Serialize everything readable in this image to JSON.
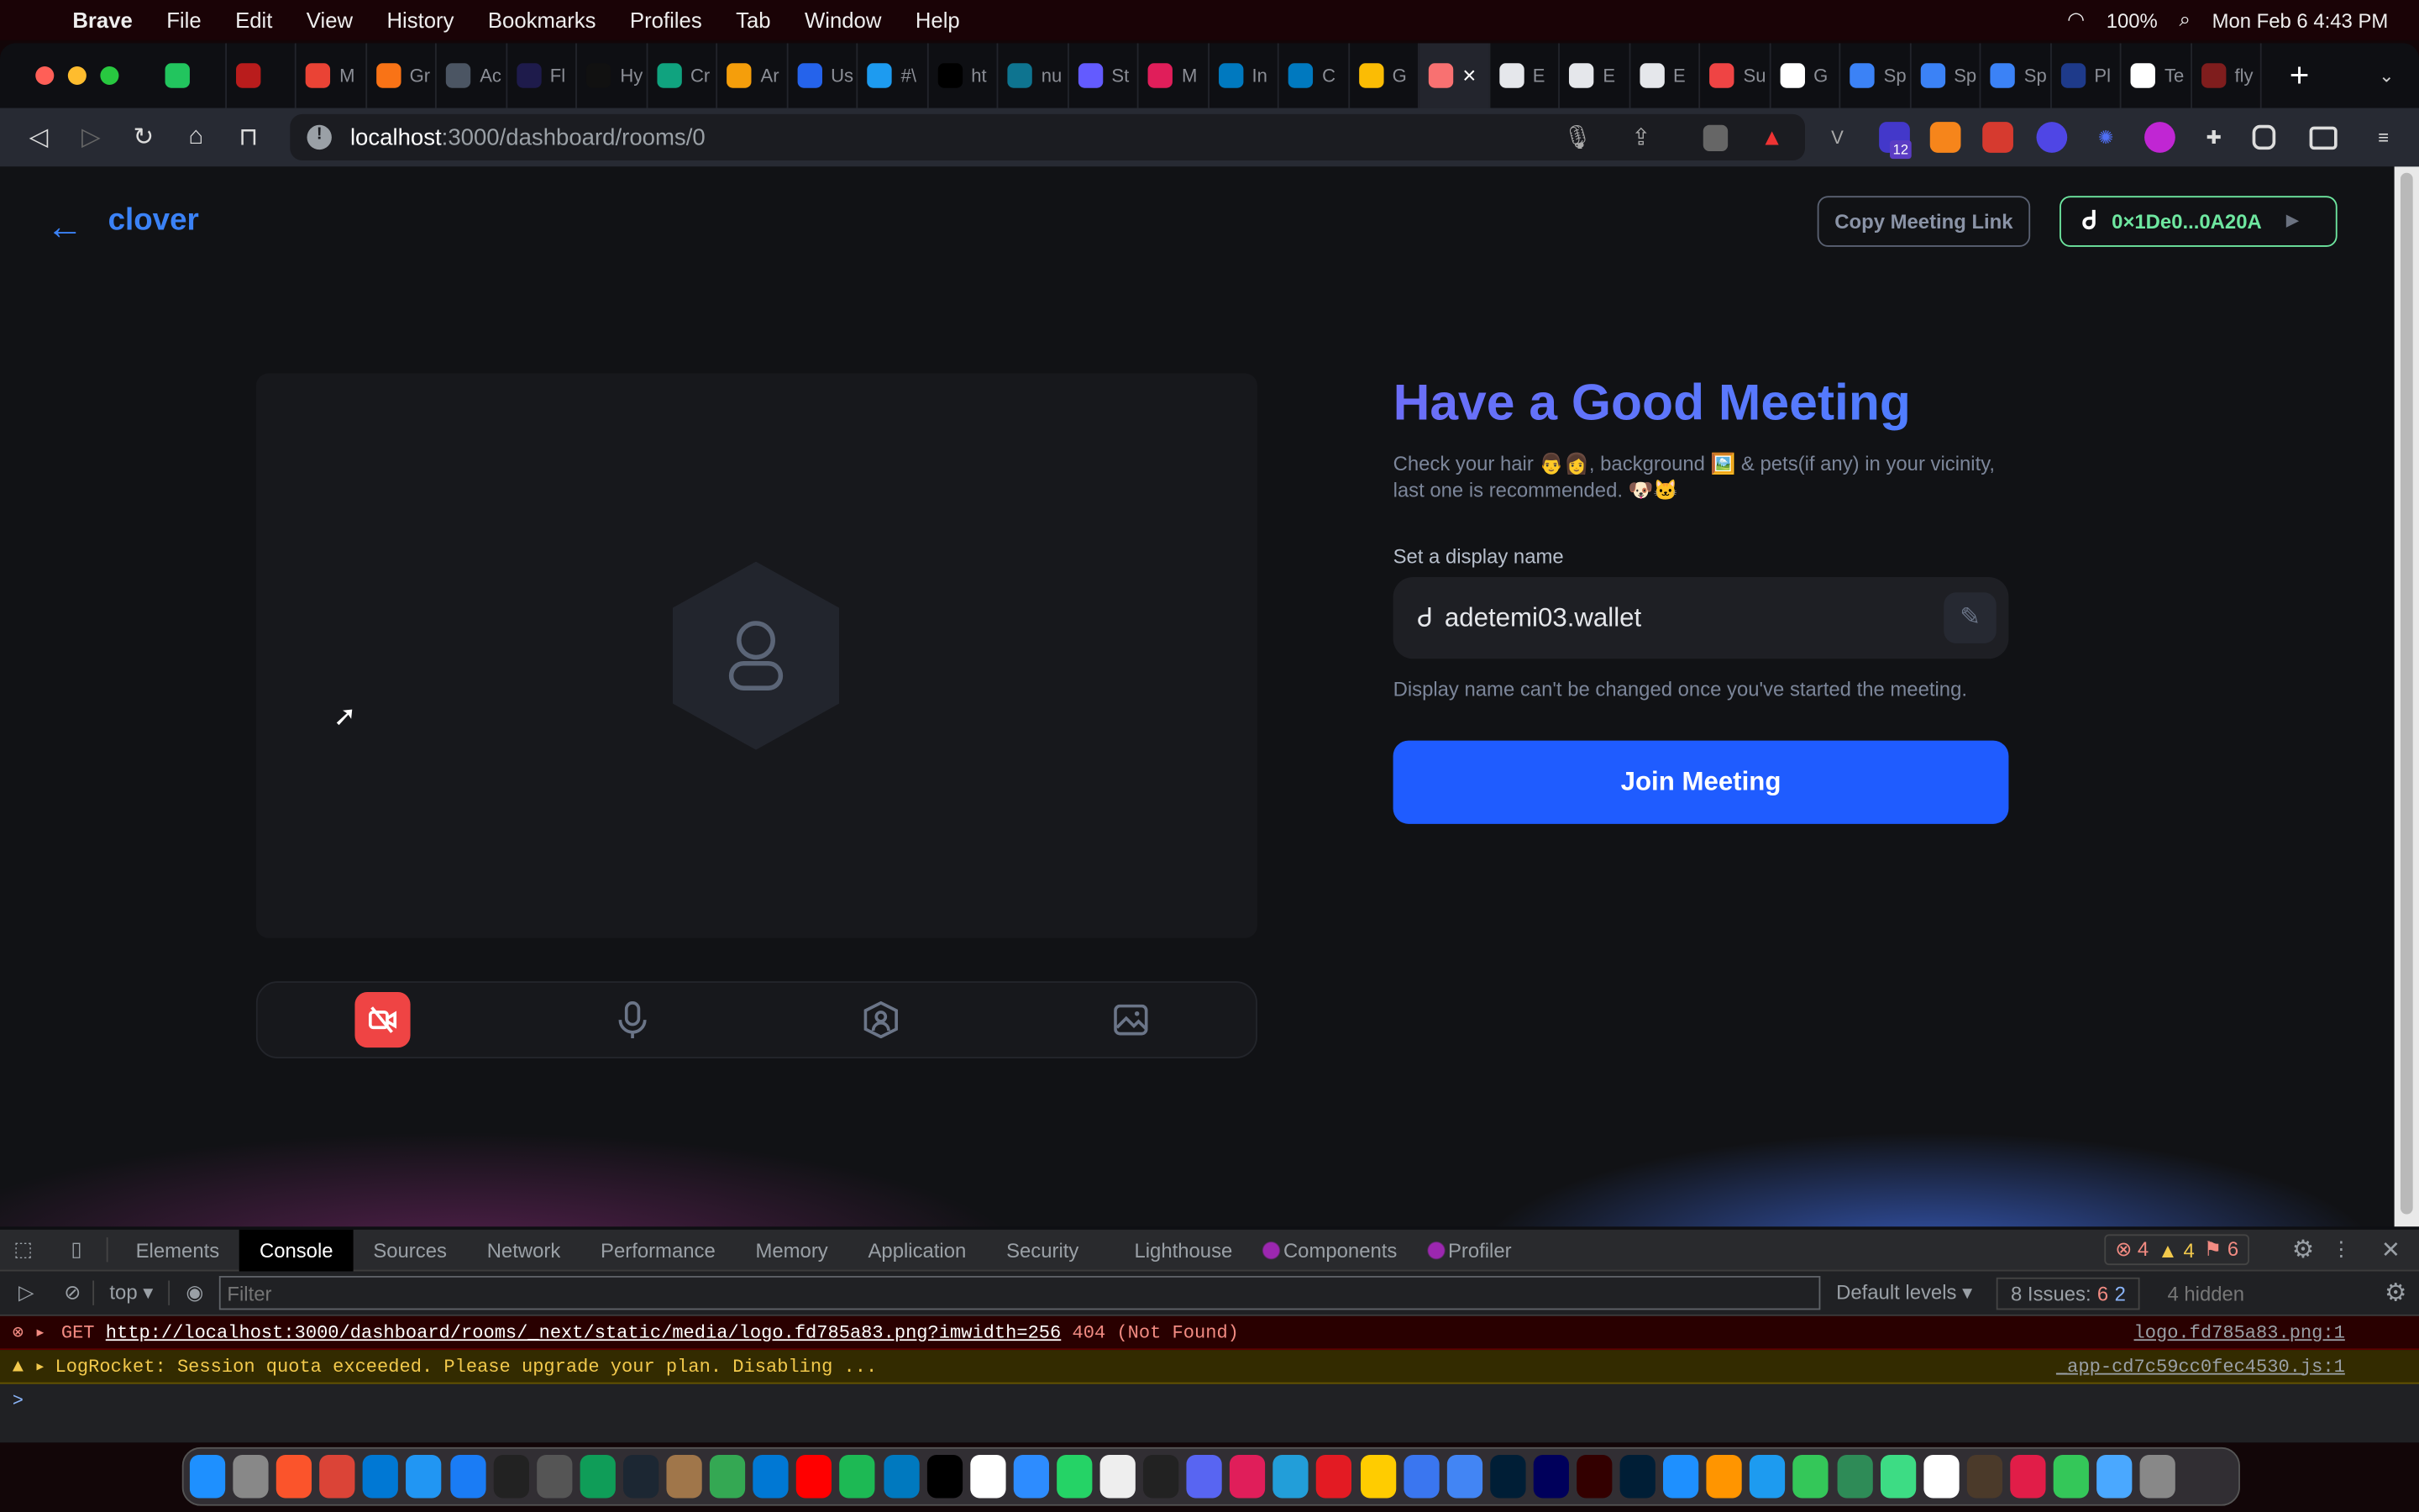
{
  "menubar": {
    "app": "Brave",
    "items": [
      "File",
      "Edit",
      "View",
      "History",
      "Bookmarks",
      "Profiles",
      "Tab",
      "Window",
      "Help"
    ],
    "battery": "100%",
    "clock": "Mon Feb 6  4:43 PM"
  },
  "tabs": [
    {
      "label": "",
      "color": "#22c55e"
    },
    {
      "label": "",
      "color": "#b91c1c"
    },
    {
      "label": "M",
      "color": "#ea4335"
    },
    {
      "label": "Gr",
      "color": "#f97316"
    },
    {
      "label": "Ac",
      "color": "#4b5563"
    },
    {
      "label": "Fl",
      "color": "#1e1b4b"
    },
    {
      "label": "Hy",
      "color": "#111"
    },
    {
      "label": "Cr",
      "color": "#10a37f"
    },
    {
      "label": "Ar",
      "color": "#f59e0b"
    },
    {
      "label": "Us",
      "color": "#2563eb"
    },
    {
      "label": "#\\",
      "color": "#1d9bf0"
    },
    {
      "label": "ht",
      "color": "#000"
    },
    {
      "label": "nu",
      "color": "#0e7490"
    },
    {
      "label": "St",
      "color": "#635bff"
    },
    {
      "label": "M",
      "color": "#e01e5a"
    },
    {
      "label": "In",
      "color": "#0079bf"
    },
    {
      "label": "C",
      "color": "#0079bf"
    },
    {
      "label": "G",
      "color": "#fbbc04"
    },
    {
      "label": "",
      "color": "#f87171",
      "active": true
    },
    {
      "label": "E",
      "color": "#e5e7eb"
    },
    {
      "label": "E",
      "color": "#e5e7eb"
    },
    {
      "label": "E",
      "color": "#e5e7eb"
    },
    {
      "label": "Su",
      "color": "#ef4444"
    },
    {
      "label": "G",
      "color": "#fff"
    },
    {
      "label": "Sp",
      "color": "#3b82f6"
    },
    {
      "label": "Sp",
      "color": "#3b82f6"
    },
    {
      "label": "Sp",
      "color": "#3b82f6"
    },
    {
      "label": "Pl",
      "color": "#1e3a8a"
    },
    {
      "label": "Te",
      "color": "#fff"
    },
    {
      "label": "fly",
      "color": "#7f1d1d"
    }
  ],
  "tab_close": "×",
  "new_tab": "+",
  "url": {
    "host": "localhost",
    "path": ":3000/dashboard/rooms/0"
  },
  "extension_badge": "12",
  "header": {
    "logo_alt": "clover",
    "copy_link": "Copy Meeting Link",
    "wallet": "0×1De0...0A20A"
  },
  "main": {
    "title": "Have a Good Meeting",
    "description": "Check your hair 👨👩, background 🖼️ & pets(if any) in your vicinity, last one is recommended. 🐶🐱",
    "name_label": "Set a display name",
    "display_name": "adetemi03.wallet",
    "helper": "Display name can't be changed once you've started the meeting.",
    "join": "Join Meeting",
    "controls": [
      "camera-off",
      "microphone",
      "avatar",
      "background"
    ]
  },
  "colors": {
    "accent": "#1f5cff",
    "wallet": "#6ee7a0",
    "danger": "#ef4444"
  },
  "devtools": {
    "tabs": [
      "Elements",
      "Console",
      "Sources",
      "Network",
      "Performance",
      "Memory",
      "Application",
      "Security",
      "Lighthouse",
      "Components",
      "Profiler"
    ],
    "active_tab": "Console",
    "errors": "4",
    "warnings": "4",
    "issues_badge": "6",
    "context": "top",
    "filter_placeholder": "Filter",
    "levels": "Default levels",
    "issues": "8 Issues:",
    "issues_err": "6",
    "issues_info": "2",
    "hidden": "4 hidden",
    "messages": [
      {
        "level": "error",
        "method": "GET",
        "url": "http://localhost:3000/dashboard/rooms/_next/static/media/logo.fd785a83.png?imwidth=256",
        "status": "404 (Not Found)",
        "source": "logo.fd785a83.png:1"
      },
      {
        "level": "warning",
        "text": "LogRocket: Session quota exceeded. Please upgrade your plan. Disabling ...",
        "source": "_app-cd7c59cc0fec4530.js:1"
      }
    ],
    "prompt": ">"
  },
  "dock": [
    "#1e90ff",
    "#888",
    "#fb542b",
    "#db4437",
    "#0078d4",
    "#2196f3",
    "#1a7cf5",
    "#222",
    "#555",
    "#0f9d58",
    "#1c2733",
    "#a0764a",
    "#34a853",
    "#0078d4",
    "#ff0000",
    "#1db954",
    "#0079bf",
    "#000",
    "#fff",
    "#2d8cff",
    "#25d366",
    "#eee",
    "#222",
    "#5865f2",
    "#e01e5a",
    "#229ed9",
    "#e31b23",
    "#ffcc00",
    "#3a76f0",
    "#4285f4",
    "#001e36",
    "#00005b",
    "#330000",
    "#001e36",
    "#1e90ff",
    "#ff9500",
    "#1d9bf0",
    "#34c759",
    "#2e8b57",
    "#3ddc84",
    "#fff",
    "#4b3a2a",
    "#e11d48",
    "#34c759",
    "#4aa8ff",
    "#888"
  ]
}
